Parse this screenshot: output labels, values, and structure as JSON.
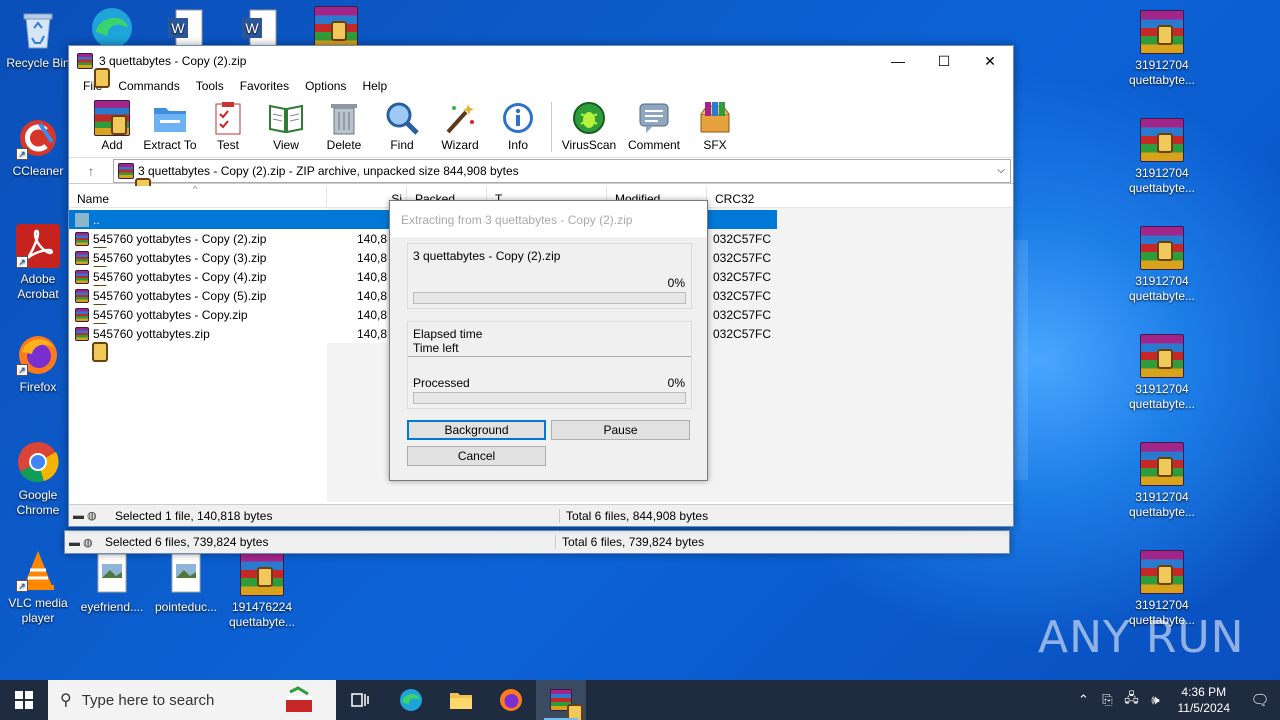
{
  "desktop": {
    "left_icons": [
      {
        "label": "Recycle Bin",
        "icon": "recycle-bin-icon"
      },
      {
        "label": "CCleaner",
        "icon": "ccleaner-icon"
      },
      {
        "label": "Adobe Acrobat",
        "icon": "acrobat-icon"
      },
      {
        "label": "Firefox",
        "icon": "firefox-icon"
      },
      {
        "label": "Google Chrome",
        "icon": "chrome-icon"
      },
      {
        "label": "VLC media player",
        "icon": "vlc-icon"
      }
    ],
    "bottom_icons": [
      {
        "label": "eyefriend....",
        "icon": "image-file-icon"
      },
      {
        "label": "pointeduc...",
        "icon": "image-file-icon"
      },
      {
        "label": "191476224 quettabyte...",
        "icon": "winrar-archive-icon"
      }
    ],
    "right_icons": [
      {
        "label": "31912704 quettabyte..."
      },
      {
        "label": "31912704 quettabyte..."
      },
      {
        "label": "31912704 quettabyte..."
      },
      {
        "label": "31912704 quettabyte..."
      },
      {
        "label": "31912704 quettabyte..."
      },
      {
        "label": "31912704 quettabyte..."
      }
    ],
    "watermark": "ANY RUN"
  },
  "winrar": {
    "title": "3 quettabytes - Copy (2).zip",
    "menu": [
      "File",
      "Commands",
      "Tools",
      "Favorites",
      "Options",
      "Help"
    ],
    "toolbar": [
      {
        "label": "Add",
        "icon": "add-archive-icon"
      },
      {
        "label": "Extract To",
        "icon": "extract-folder-icon"
      },
      {
        "label": "Test",
        "icon": "test-clipboard-icon"
      },
      {
        "label": "View",
        "icon": "view-book-icon"
      },
      {
        "label": "Delete",
        "icon": "trash-icon"
      },
      {
        "label": "Find",
        "icon": "magnifier-icon"
      },
      {
        "label": "Wizard",
        "icon": "wizard-wand-icon"
      },
      {
        "label": "Info",
        "icon": "info-icon"
      },
      {
        "label": "VirusScan",
        "icon": "virus-scan-icon"
      },
      {
        "label": "Comment",
        "icon": "comment-icon"
      },
      {
        "label": "SFX",
        "icon": "sfx-box-icon"
      }
    ],
    "address": "3 quettabytes - Copy (2).zip - ZIP archive, unpacked size 844,908 bytes",
    "columns": {
      "name": "Name",
      "size": "Si",
      "packed": "Packed",
      "type": "T",
      "modified": "Modified",
      "crc": "CRC32"
    },
    "parent_row": "..",
    "files": [
      {
        "name": "545760 yottabytes - Copy (2).zip",
        "size": "140,8",
        "crc": "032C57FC"
      },
      {
        "name": "545760 yottabytes - Copy (3).zip",
        "size": "140,8",
        "crc": "032C57FC"
      },
      {
        "name": "545760 yottabytes - Copy (4).zip",
        "size": "140,8",
        "crc": "032C57FC"
      },
      {
        "name": "545760 yottabytes - Copy (5).zip",
        "size": "140,8",
        "crc": "032C57FC"
      },
      {
        "name": "545760 yottabytes - Copy.zip",
        "size": "140,8",
        "crc": "032C57FC"
      },
      {
        "name": "545760 yottabytes.zip",
        "size": "140,8",
        "crc": "032C57FC"
      }
    ],
    "status_left": "Selected 1 file, 140,818 bytes",
    "status_right": "Total 6 files, 844,908 bytes"
  },
  "background_window": {
    "status_left": "Selected 6 files, 739,824 bytes",
    "status_right": "Total 6 files, 739,824 bytes"
  },
  "extract_dialog": {
    "title": "Extracting from 3 quettabytes - Copy (2).zip",
    "current_file": "3 quettabytes - Copy (2).zip",
    "file_percent_label": "0%",
    "file_progress": 0,
    "elapsed_label": "Elapsed time",
    "time_left_label": "Time left",
    "processed_label": "Processed",
    "processed_percent_label": "0%",
    "processed_progress": 0,
    "buttons": {
      "background": "Background",
      "pause": "Pause",
      "cancel": "Cancel"
    }
  },
  "taskbar": {
    "search_placeholder": "Type here to search",
    "time": "4:36 PM",
    "date": "11/5/2024",
    "apps": [
      "task-view-icon",
      "edge-icon",
      "file-explorer-icon",
      "firefox-icon",
      "winrar-icon"
    ]
  },
  "colors": {
    "accent": "#0078d7",
    "taskbar": "#1f2c3f",
    "desktop": "#0c63d6"
  }
}
